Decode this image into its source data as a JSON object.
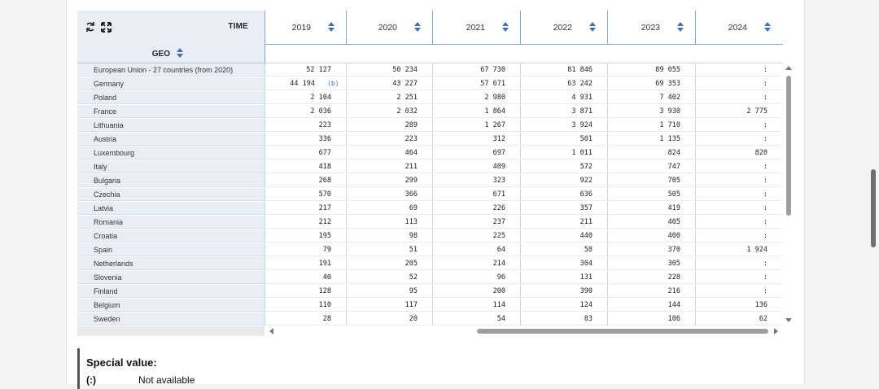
{
  "header": {
    "time_label": "TIME",
    "geo_label": "GEO",
    "years": [
      "2019",
      "2020",
      "2021",
      "2022",
      "2023",
      "2024"
    ],
    "rotate_icon": "rotate-icon",
    "expand_icon": "expand-icon"
  },
  "rows": [
    {
      "geo": "European Union - 27 countries (from 2020)",
      "values": [
        "52 127",
        "50 234",
        "67 730",
        "81 846",
        "89 055",
        ":"
      ]
    },
    {
      "geo": "Germany",
      "values": [
        "44 194",
        "43 227",
        "57 671",
        "63 242",
        "69 353",
        ":"
      ],
      "flag": "(b)"
    },
    {
      "geo": "Poland",
      "values": [
        "2 104",
        "2 251",
        "2 980",
        "4 931",
        "7 402",
        ":"
      ]
    },
    {
      "geo": "France",
      "values": [
        "2 036",
        "2 032",
        "1 864",
        "3 871",
        "3 930",
        "2 775"
      ]
    },
    {
      "geo": "Lithuania",
      "values": [
        "223",
        "289",
        "1 267",
        "3 924",
        "1 710",
        ":"
      ]
    },
    {
      "geo": "Austria",
      "values": [
        "336",
        "223",
        "312",
        "501",
        "1 135",
        ":"
      ]
    },
    {
      "geo": "Luxembourg",
      "values": [
        "677",
        "464",
        "697",
        "1 011",
        "824",
        "820"
      ]
    },
    {
      "geo": "Italy",
      "values": [
        "418",
        "211",
        "409",
        "572",
        "747",
        ":"
      ]
    },
    {
      "geo": "Bulgaria",
      "values": [
        "268",
        "299",
        "323",
        "922",
        "705",
        ":"
      ]
    },
    {
      "geo": "Czechia",
      "values": [
        "570",
        "366",
        "671",
        "636",
        "505",
        ":"
      ]
    },
    {
      "geo": "Latvia",
      "values": [
        "217",
        "69",
        "226",
        "357",
        "419",
        ":"
      ]
    },
    {
      "geo": "Romania",
      "values": [
        "212",
        "113",
        "237",
        "211",
        "405",
        ":"
      ]
    },
    {
      "geo": "Croatia",
      "values": [
        "195",
        "98",
        "225",
        "440",
        "400",
        ":"
      ]
    },
    {
      "geo": "Spain",
      "values": [
        "79",
        "51",
        "64",
        "58",
        "370",
        "1 924"
      ]
    },
    {
      "geo": "Netherlands",
      "values": [
        "191",
        "205",
        "214",
        "304",
        "305",
        ":"
      ]
    },
    {
      "geo": "Slovenia",
      "values": [
        "40",
        "52",
        "96",
        "131",
        "228",
        ":"
      ]
    },
    {
      "geo": "Finland",
      "values": [
        "128",
        "95",
        "200",
        "390",
        "216",
        ":"
      ]
    },
    {
      "geo": "Belgium",
      "values": [
        "110",
        "117",
        "114",
        "124",
        "144",
        "136"
      ]
    },
    {
      "geo": "Sweden",
      "values": [
        "28",
        "20",
        "54",
        "83",
        "106",
        "62"
      ]
    }
  ],
  "special": {
    "title": "Special value:",
    "code": "(:)",
    "description": "Not available"
  },
  "colors": {
    "accent": "#3f6fb3",
    "header_bg": "#e9eef6",
    "scroll_thumb": "#9e9e9e"
  }
}
